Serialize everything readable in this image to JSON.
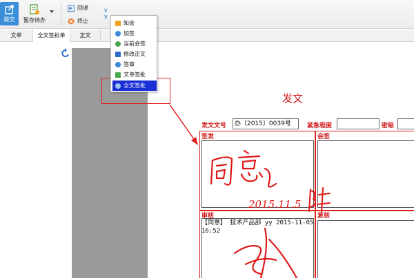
{
  "toolbar": {
    "submit_label": "提交",
    "draft_label": "暂存待办",
    "back_label": "回退",
    "stop_label": "终止"
  },
  "tabs": [
    "文单",
    "全文签批单",
    "正文"
  ],
  "menu": {
    "items": [
      "知会",
      "加签",
      "当前会签",
      "修改正文",
      "签章",
      "文单签批",
      "全文签批"
    ],
    "selected": "全文签批"
  },
  "document": {
    "title": "发文",
    "doc_number_label": "发文文号",
    "doc_number_value": "办〔2015〕0039号",
    "urgency_label": "紧急程度",
    "urgency_value": "",
    "secret_label": "密级",
    "secret_value": "",
    "sign_label": "签发",
    "countersign_label": "会签",
    "audit_label": "审核",
    "recheck_label": "复核",
    "handwriting_sign": "同意",
    "handwriting_date": "2015.11.5",
    "review_text": "【同意】 技术产品部 yy 2015-11-05 16:52"
  },
  "colors": {
    "accent_red": "#d01a1a",
    "selected_menu": "#1a2fd6",
    "submit_blue": "#3b8fd9"
  }
}
